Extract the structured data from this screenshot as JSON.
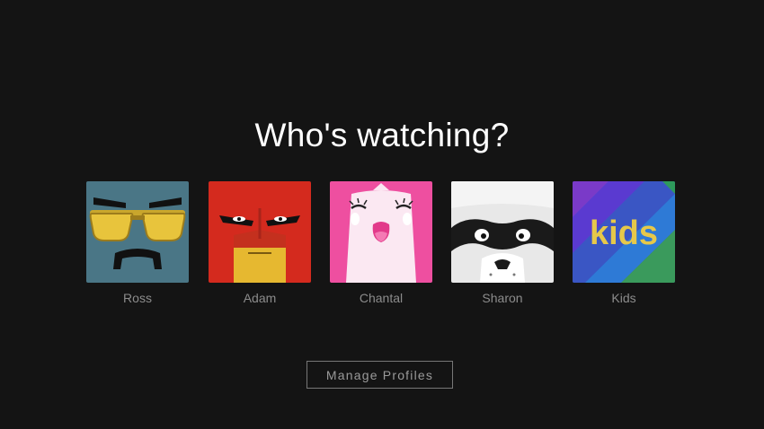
{
  "header": {
    "title": "Who's watching?"
  },
  "profiles": [
    {
      "name": "Ross",
      "avatar": "sunglasses-mustache-icon",
      "color": "#4a7686"
    },
    {
      "name": "Adam",
      "avatar": "red-masked-hero-icon",
      "color": "#d42a1e"
    },
    {
      "name": "Chantal",
      "avatar": "pink-happy-face-icon",
      "color": "#ee4fa0"
    },
    {
      "name": "Sharon",
      "avatar": "raccoon-mask-icon",
      "color": "#e8e8e8"
    },
    {
      "name": "Kids",
      "avatar": "kids-logo-icon",
      "color": "#3a56c4",
      "logo_text": "kids"
    }
  ],
  "actions": {
    "manage_label": "Manage Profiles"
  },
  "colors": {
    "background": "#141414",
    "title": "#ffffff",
    "name": "#8c8c8c",
    "kids_yellow": "#e6c84a"
  }
}
